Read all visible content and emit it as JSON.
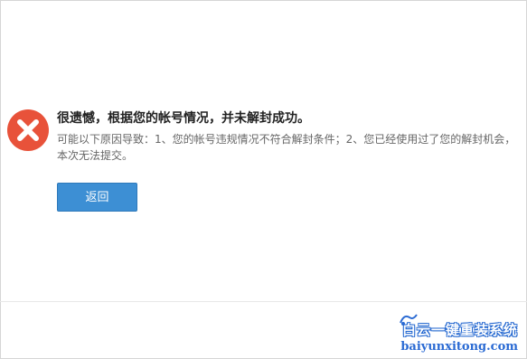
{
  "message": {
    "title": "很遗憾，根据您的帐号情况，并未解封成功。",
    "description": "可能以下原因导致：1、您的帐号违规情况不符合解封条件；2、您已经使用过了您的解封机会，本次无法提交。"
  },
  "actions": {
    "back_label": "返回"
  },
  "watermark": {
    "cn": "白云一键重装系统",
    "en": "baiyunxitong.com"
  },
  "colors": {
    "error_red": "#e8523a",
    "button_blue": "#3d8fd4",
    "watermark_blue": "#2a6ad3"
  },
  "icons": [
    "error-icon",
    "watermark-logo-icon"
  ]
}
